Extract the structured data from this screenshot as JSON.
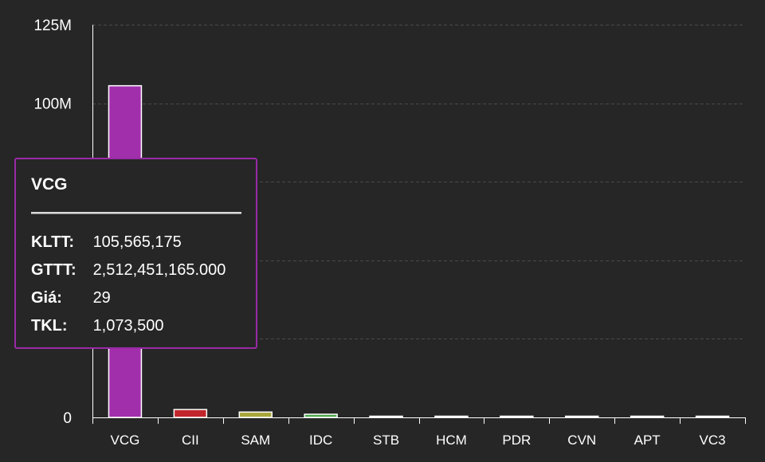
{
  "chart_data": {
    "type": "bar",
    "categories": [
      "VCG",
      "CII",
      "SAM",
      "IDC",
      "STB",
      "HCM",
      "PDR",
      "CVN",
      "APT",
      "VC3"
    ],
    "values": [
      105565175,
      2500000,
      1700000,
      1000000,
      280000,
      230000,
      200000,
      180000,
      170000,
      160000
    ],
    "colors": [
      "#a12fab",
      "#c0262b",
      "#a8a73a",
      "#4aa54a",
      "#e6e6e6",
      "#e6e6e6",
      "#e6e6e6",
      "#e6e6e6",
      "#e6e6e6",
      "#e6e6e6"
    ],
    "ylim": [
      0,
      125000000
    ],
    "yticks": [
      {
        "value": 0,
        "label": "0"
      },
      {
        "value": 100000000,
        "label": "100M"
      },
      {
        "value": 125000000,
        "label": "125M"
      }
    ],
    "gridlines": [
      25000000,
      50000000,
      75000000,
      100000000,
      125000000
    ],
    "grid": true,
    "title": "",
    "xlabel": "",
    "ylabel": ""
  },
  "tooltip": {
    "title": "VCG",
    "rows": [
      {
        "label": "KLTT:",
        "value": "105,565,175"
      },
      {
        "label": "GTTT:",
        "value": "2,512,451,165.000"
      },
      {
        "label": "Giá:",
        "value": "29"
      },
      {
        "label": "TKL:",
        "value": "1,073,500"
      }
    ],
    "border_color": "#9a2aa6"
  },
  "colors": {
    "background": "#262626",
    "axis": "#ffffff",
    "grid": "#4a4a4a",
    "text": "#ffffff"
  }
}
